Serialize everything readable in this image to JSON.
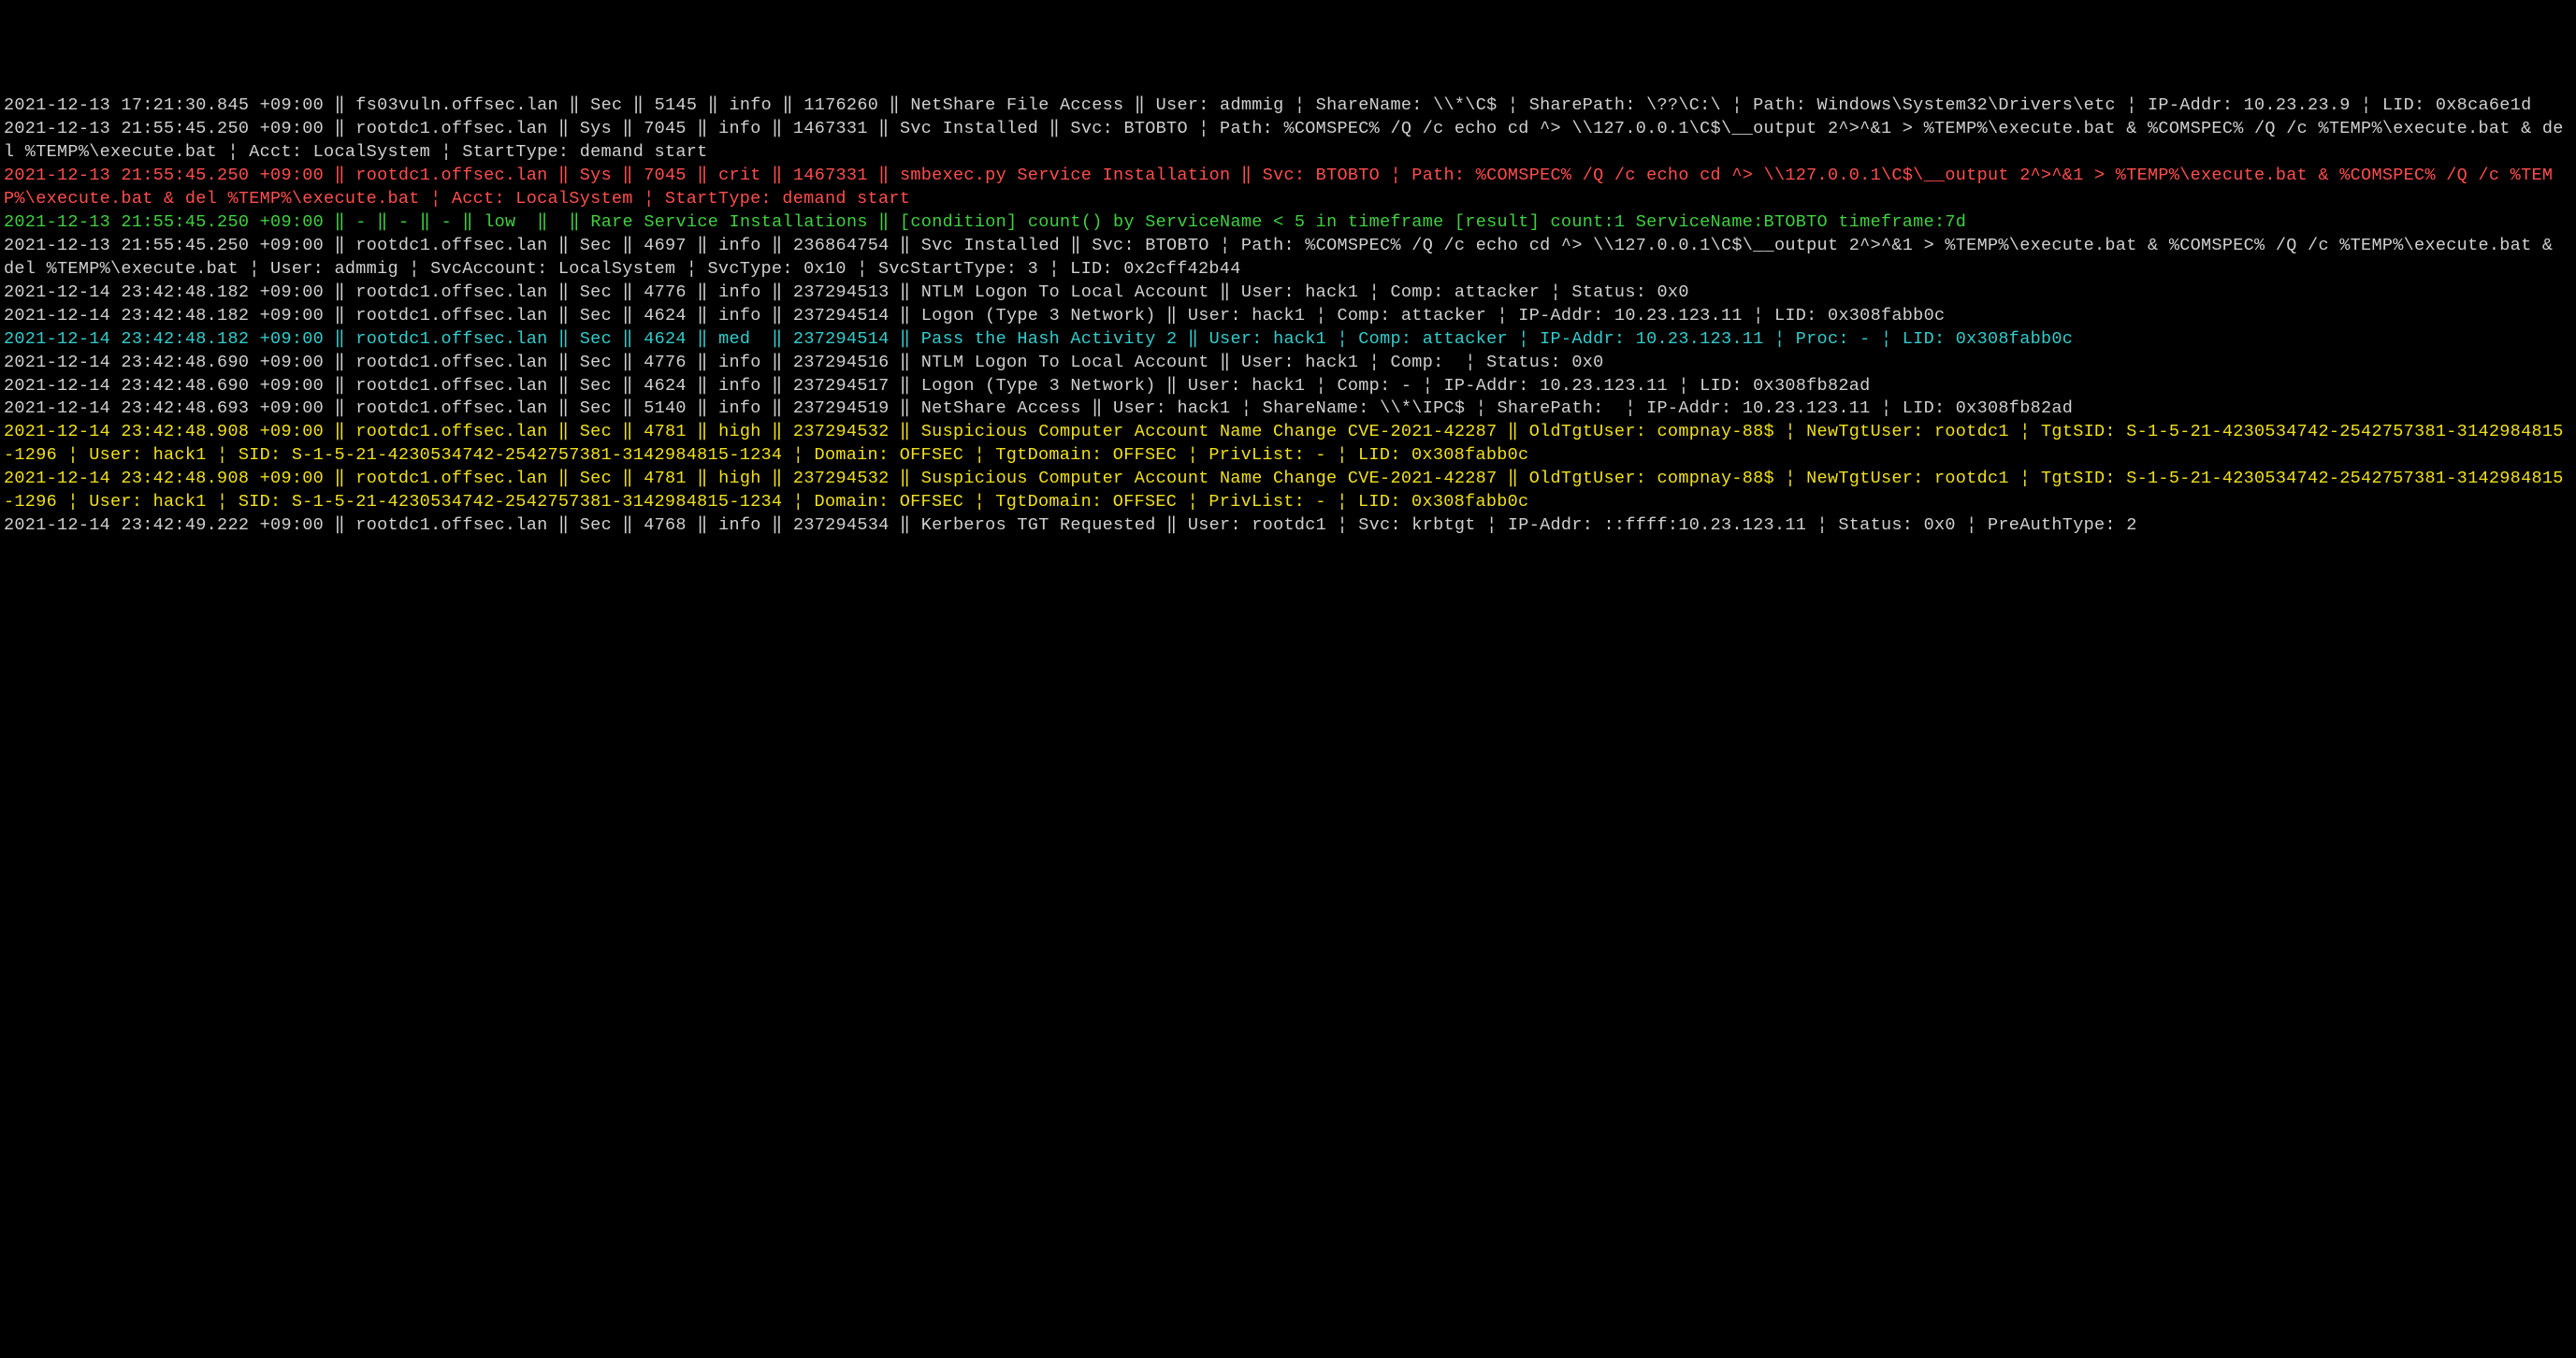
{
  "lines": [
    {
      "color": "c-white",
      "text": "2021-12-13 17:21:30.845 +09:00 ‖ fs03vuln.offsec.lan ‖ Sec ‖ 5145 ‖ info ‖ 1176260 ‖ NetShare File Access ‖ User: admmig ¦ ShareName: \\\\*\\C$ ¦ SharePath: \\??\\C:\\ ¦ Path: Windows\\System32\\Drivers\\etc ¦ IP-Addr: 10.23.23.9 ¦ LID: 0x8ca6e1d"
    },
    {
      "color": "c-white",
      "text": "2021-12-13 21:55:45.250 +09:00 ‖ rootdc1.offsec.lan ‖ Sys ‖ 7045 ‖ info ‖ 1467331 ‖ Svc Installed ‖ Svc: BTOBTO ¦ Path: %COMSPEC% /Q /c echo cd ^> \\\\127.0.0.1\\C$\\__output 2^>^&1 > %TEMP%\\execute.bat & %COMSPEC% /Q /c %TEMP%\\execute.bat & del %TEMP%\\execute.bat ¦ Acct: LocalSystem ¦ StartType: demand start"
    },
    {
      "color": "c-red",
      "text": "2021-12-13 21:55:45.250 +09:00 ‖ rootdc1.offsec.lan ‖ Sys ‖ 7045 ‖ crit ‖ 1467331 ‖ smbexec.py Service Installation ‖ Svc: BTOBTO ¦ Path: %COMSPEC% /Q /c echo cd ^> \\\\127.0.0.1\\C$\\__output 2^>^&1 > %TEMP%\\execute.bat & %COMSPEC% /Q /c %TEMP%\\execute.bat & del %TEMP%\\execute.bat ¦ Acct: LocalSystem ¦ StartType: demand start"
    },
    {
      "color": "c-green",
      "text": "2021-12-13 21:55:45.250 +09:00 ‖ - ‖ - ‖ - ‖ low  ‖  ‖ Rare Service Installations ‖ [condition] count() by ServiceName < 5 in timeframe [result] count:1 ServiceName:BTOBTO timeframe:7d"
    },
    {
      "color": "c-white",
      "text": "2021-12-13 21:55:45.250 +09:00 ‖ rootdc1.offsec.lan ‖ Sec ‖ 4697 ‖ info ‖ 236864754 ‖ Svc Installed ‖ Svc: BTOBTO ¦ Path: %COMSPEC% /Q /c echo cd ^> \\\\127.0.0.1\\C$\\__output 2^>^&1 > %TEMP%\\execute.bat & %COMSPEC% /Q /c %TEMP%\\execute.bat & del %TEMP%\\execute.bat ¦ User: admmig ¦ SvcAccount: LocalSystem ¦ SvcType: 0x10 ¦ SvcStartType: 3 ¦ LID: 0x2cff42b44"
    },
    {
      "color": "c-white",
      "text": "2021-12-14 23:42:48.182 +09:00 ‖ rootdc1.offsec.lan ‖ Sec ‖ 4776 ‖ info ‖ 237294513 ‖ NTLM Logon To Local Account ‖ User: hack1 ¦ Comp: attacker ¦ Status: 0x0"
    },
    {
      "color": "c-white",
      "text": "2021-12-14 23:42:48.182 +09:00 ‖ rootdc1.offsec.lan ‖ Sec ‖ 4624 ‖ info ‖ 237294514 ‖ Logon (Type 3 Network) ‖ User: hack1 ¦ Comp: attacker ¦ IP-Addr: 10.23.123.11 ¦ LID: 0x308fabb0c"
    },
    {
      "color": "c-cyan",
      "text": "2021-12-14 23:42:48.182 +09:00 ‖ rootdc1.offsec.lan ‖ Sec ‖ 4624 ‖ med  ‖ 237294514 ‖ Pass the Hash Activity 2 ‖ User: hack1 ¦ Comp: attacker ¦ IP-Addr: 10.23.123.11 ¦ Proc: - ¦ LID: 0x308fabb0c"
    },
    {
      "color": "c-white",
      "text": "2021-12-14 23:42:48.690 +09:00 ‖ rootdc1.offsec.lan ‖ Sec ‖ 4776 ‖ info ‖ 237294516 ‖ NTLM Logon To Local Account ‖ User: hack1 ¦ Comp:  ¦ Status: 0x0"
    },
    {
      "color": "c-white",
      "text": "2021-12-14 23:42:48.690 +09:00 ‖ rootdc1.offsec.lan ‖ Sec ‖ 4624 ‖ info ‖ 237294517 ‖ Logon (Type 3 Network) ‖ User: hack1 ¦ Comp: - ¦ IP-Addr: 10.23.123.11 ¦ LID: 0x308fb82ad"
    },
    {
      "color": "c-white",
      "text": "2021-12-14 23:42:48.693 +09:00 ‖ rootdc1.offsec.lan ‖ Sec ‖ 5140 ‖ info ‖ 237294519 ‖ NetShare Access ‖ User: hack1 ¦ ShareName: \\\\*\\IPC$ ¦ SharePath:  ¦ IP-Addr: 10.23.123.11 ¦ LID: 0x308fb82ad"
    },
    {
      "color": "c-yellow",
      "text": "2021-12-14 23:42:48.908 +09:00 ‖ rootdc1.offsec.lan ‖ Sec ‖ 4781 ‖ high ‖ 237294532 ‖ Suspicious Computer Account Name Change CVE-2021-42287 ‖ OldTgtUser: compnay-88$ ¦ NewTgtUser: rootdc1 ¦ TgtSID: S-1-5-21-4230534742-2542757381-3142984815-1296 ¦ User: hack1 ¦ SID: S-1-5-21-4230534742-2542757381-3142984815-1234 ¦ Domain: OFFSEC ¦ TgtDomain: OFFSEC ¦ PrivList: - ¦ LID: 0x308fabb0c"
    },
    {
      "color": "c-yellow",
      "text": "2021-12-14 23:42:48.908 +09:00 ‖ rootdc1.offsec.lan ‖ Sec ‖ 4781 ‖ high ‖ 237294532 ‖ Suspicious Computer Account Name Change CVE-2021-42287 ‖ OldTgtUser: compnay-88$ ¦ NewTgtUser: rootdc1 ¦ TgtSID: S-1-5-21-4230534742-2542757381-3142984815-1296 ¦ User: hack1 ¦ SID: S-1-5-21-4230534742-2542757381-3142984815-1234 ¦ Domain: OFFSEC ¦ TgtDomain: OFFSEC ¦ PrivList: - ¦ LID: 0x308fabb0c"
    },
    {
      "color": "c-white",
      "text": "2021-12-14 23:42:49.222 +09:00 ‖ rootdc1.offsec.lan ‖ Sec ‖ 4768 ‖ info ‖ 237294534 ‖ Kerberos TGT Requested ‖ User: rootdc1 ¦ Svc: krbtgt ¦ IP-Addr: ::ffff:10.23.123.11 ¦ Status: 0x0 ¦ PreAuthType: 2"
    }
  ]
}
